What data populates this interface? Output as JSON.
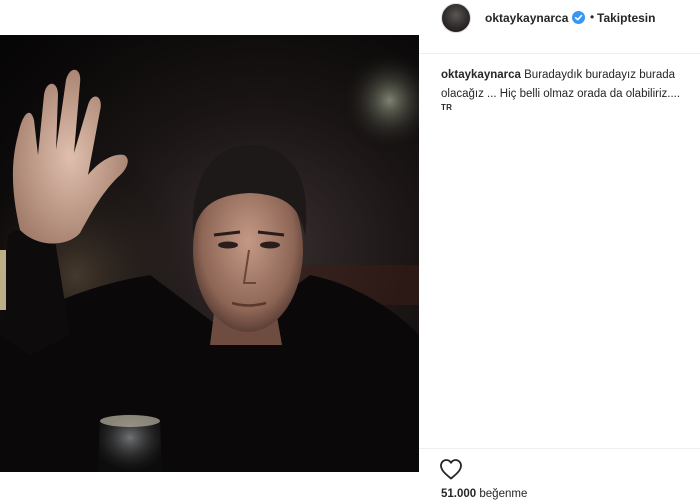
{
  "post": {
    "username": "oktaykaynarca",
    "verified": true,
    "verified_icon": "verified-badge-icon",
    "follow_separator": "•",
    "follow_status": "Takiptesin",
    "caption_user": "oktaykaynarca",
    "caption_text": "Buradaydık buradayız burada olacağız ... Hiç belli olmaz orada da olabiliriz....",
    "translate_label": "TR",
    "like_icon": "heart-outline-icon",
    "likes_count": "51.000",
    "likes_label": "beğenme"
  },
  "colors": {
    "text": "#262626",
    "verified_blue": "#3897f0",
    "divider": "#efefef",
    "background": "#ffffff"
  }
}
